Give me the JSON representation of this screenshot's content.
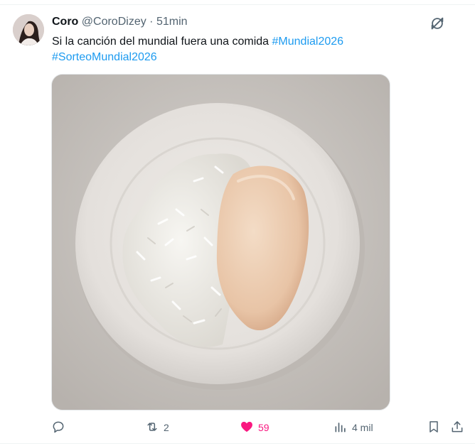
{
  "post": {
    "author_name": "Coro",
    "author_handle": "@CoroDizey",
    "separator": "·",
    "time_ago": "51min",
    "text": "Si la canción del mundial fuera una comida ",
    "hashtags": [
      "#Mundial2026",
      "#SorteoMundial2026"
    ],
    "media": {
      "description_icon": "photo"
    },
    "stats": {
      "replies": "",
      "reposts": "2",
      "likes": "59",
      "views": "4 mil"
    }
  },
  "colors": {
    "accent": "#1d9bf0",
    "like": "#f91880",
    "secondary_text": "#536471"
  },
  "icons": [
    "grok-icon",
    "reply-icon",
    "repost-icon",
    "like-icon",
    "views-icon",
    "bookmark-icon",
    "share-icon"
  ]
}
